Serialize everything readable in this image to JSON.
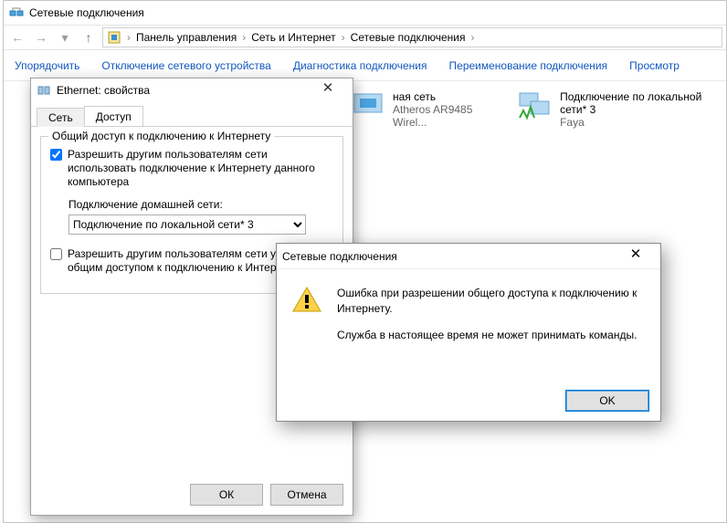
{
  "window": {
    "title": "Сетевые подключения"
  },
  "breadcrumb": {
    "items": [
      "Панель управления",
      "Сеть и Интернет",
      "Сетевые подключения"
    ]
  },
  "toolbar": {
    "organize": "Упорядочить",
    "disable": "Отключение сетевого устройства",
    "diagnose": "Диагностика подключения",
    "rename": "Переименование подключения",
    "view": "Просмотр"
  },
  "connections": [
    {
      "name": "ная сеть",
      "status": "",
      "adapter": "Atheros AR9485 Wirel..."
    },
    {
      "name": "Подключение по локальной сети* 3",
      "status": "Faya"
    }
  ],
  "props": {
    "title": "Ethernet: свойства",
    "tab_net": "Сеть",
    "tab_access": "Доступ",
    "group_legend": "Общий доступ к подключению к Интернету",
    "chk1": "Разрешить другим пользователям сети использовать подключение к Интернету данного компьютера",
    "home_label": "Подключение домашней сети:",
    "home_value": "Подключение по локальной сети* 3",
    "chk2": "Разрешить другим пользователям сети управление общим доступом к подключению к Интернету",
    "ok": "ОК",
    "cancel": "Отмена"
  },
  "error": {
    "title": "Сетевые подключения",
    "msg1": "Ошибка при разрешении общего доступа к подключению к Интернету.",
    "msg2": "Служба в настоящее время не может принимать команды.",
    "ok": "OK"
  }
}
